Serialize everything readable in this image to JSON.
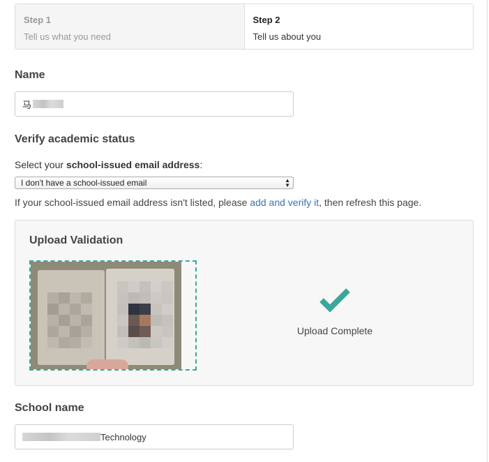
{
  "steps": [
    {
      "title": "Step 1",
      "description": "Tell us what you need"
    },
    {
      "title": "Step 2",
      "description": "Tell us about you"
    }
  ],
  "name_section": {
    "label": "Name",
    "value_prefix": "马"
  },
  "academic": {
    "label": "Verify academic status",
    "select_prefix": "Select your ",
    "select_bold": "school-issued email address",
    "select_suffix": ":",
    "selected_option": "I don't have a school-issued email",
    "hint_prefix": "If your school-issued email address isn't listed, please ",
    "hint_link": "add and verify it",
    "hint_suffix": ", then refresh this page."
  },
  "upload": {
    "title": "Upload Validation",
    "status": "Upload Complete"
  },
  "school": {
    "label": "School name",
    "value_suffix": "Technology"
  },
  "colors": {
    "accent": "#3aa898",
    "link": "#3a72b8"
  }
}
